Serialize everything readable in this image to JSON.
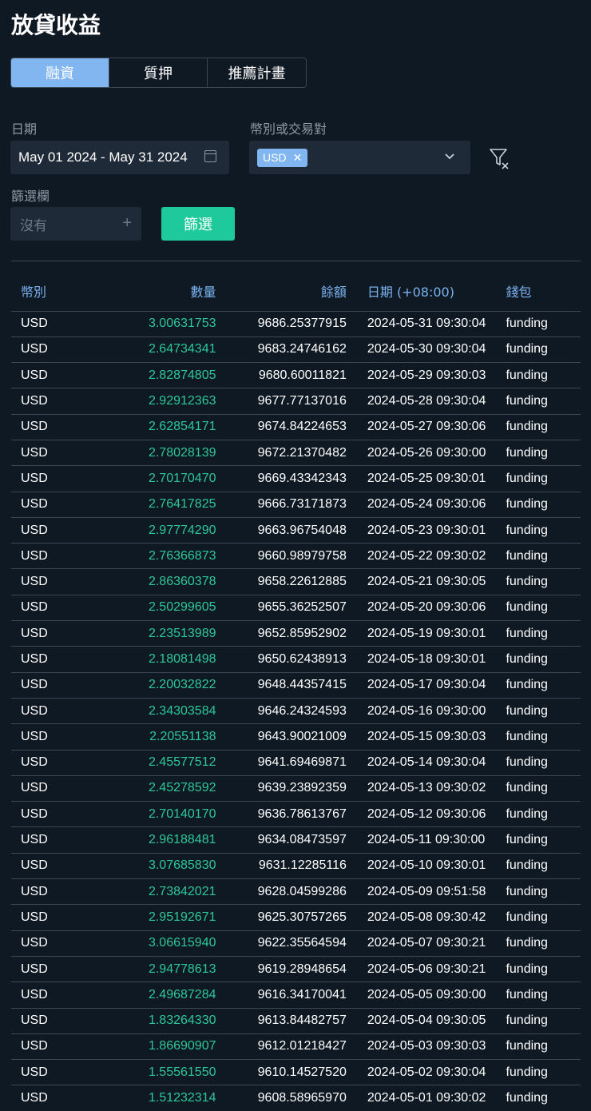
{
  "page": {
    "title": "放貸收益"
  },
  "tabs": [
    {
      "label": "融資",
      "active": true
    },
    {
      "label": "質押",
      "active": false
    },
    {
      "label": "推薦計畫",
      "active": false
    }
  ],
  "filters": {
    "date_label": "日期",
    "date_range": "May 01 2024 - May 31 2024",
    "currency_label": "幣別或交易對",
    "currency_chip": "USD",
    "chip_remove_icon": "close-icon",
    "filter_col_label": "篩選欄",
    "filter_col_placeholder": "沒有",
    "filter_button": "篩選"
  },
  "colors": {
    "accent_blue": "#82b6f0",
    "green": "#1ec99b",
    "amount_green": "#2ec79a",
    "bg": "#0f1923"
  },
  "table": {
    "headers": [
      "幣別",
      "數量",
      "餘額",
      "日期 (+08:00)",
      "錢包"
    ],
    "rows": [
      [
        "USD",
        "3.00631753",
        "9686.25377915",
        "2024-05-31 09:30:04",
        "funding"
      ],
      [
        "USD",
        "2.64734341",
        "9683.24746162",
        "2024-05-30 09:30:04",
        "funding"
      ],
      [
        "USD",
        "2.82874805",
        "9680.60011821",
        "2024-05-29 09:30:03",
        "funding"
      ],
      [
        "USD",
        "2.92912363",
        "9677.77137016",
        "2024-05-28 09:30:04",
        "funding"
      ],
      [
        "USD",
        "2.62854171",
        "9674.84224653",
        "2024-05-27 09:30:06",
        "funding"
      ],
      [
        "USD",
        "2.78028139",
        "9672.21370482",
        "2024-05-26 09:30:00",
        "funding"
      ],
      [
        "USD",
        "2.70170470",
        "9669.43342343",
        "2024-05-25 09:30:01",
        "funding"
      ],
      [
        "USD",
        "2.76417825",
        "9666.73171873",
        "2024-05-24 09:30:06",
        "funding"
      ],
      [
        "USD",
        "2.97774290",
        "9663.96754048",
        "2024-05-23 09:30:01",
        "funding"
      ],
      [
        "USD",
        "2.76366873",
        "9660.98979758",
        "2024-05-22 09:30:02",
        "funding"
      ],
      [
        "USD",
        "2.86360378",
        "9658.22612885",
        "2024-05-21 09:30:05",
        "funding"
      ],
      [
        "USD",
        "2.50299605",
        "9655.36252507",
        "2024-05-20 09:30:06",
        "funding"
      ],
      [
        "USD",
        "2.23513989",
        "9652.85952902",
        "2024-05-19 09:30:01",
        "funding"
      ],
      [
        "USD",
        "2.18081498",
        "9650.62438913",
        "2024-05-18 09:30:01",
        "funding"
      ],
      [
        "USD",
        "2.20032822",
        "9648.44357415",
        "2024-05-17 09:30:04",
        "funding"
      ],
      [
        "USD",
        "2.34303584",
        "9646.24324593",
        "2024-05-16 09:30:00",
        "funding"
      ],
      [
        "USD",
        "2.20551138",
        "9643.90021009",
        "2024-05-15 09:30:03",
        "funding"
      ],
      [
        "USD",
        "2.45577512",
        "9641.69469871",
        "2024-05-14 09:30:04",
        "funding"
      ],
      [
        "USD",
        "2.45278592",
        "9639.23892359",
        "2024-05-13 09:30:02",
        "funding"
      ],
      [
        "USD",
        "2.70140170",
        "9636.78613767",
        "2024-05-12 09:30:06",
        "funding"
      ],
      [
        "USD",
        "2.96188481",
        "9634.08473597",
        "2024-05-11 09:30:00",
        "funding"
      ],
      [
        "USD",
        "3.07685830",
        "9631.12285116",
        "2024-05-10 09:30:01",
        "funding"
      ],
      [
        "USD",
        "2.73842021",
        "9628.04599286",
        "2024-05-09 09:51:58",
        "funding"
      ],
      [
        "USD",
        "2.95192671",
        "9625.30757265",
        "2024-05-08 09:30:42",
        "funding"
      ],
      [
        "USD",
        "3.06615940",
        "9622.35564594",
        "2024-05-07 09:30:21",
        "funding"
      ],
      [
        "USD",
        "2.94778613",
        "9619.28948654",
        "2024-05-06 09:30:21",
        "funding"
      ],
      [
        "USD",
        "2.49687284",
        "9616.34170041",
        "2024-05-05 09:30:00",
        "funding"
      ],
      [
        "USD",
        "1.83264330",
        "9613.84482757",
        "2024-05-04 09:30:05",
        "funding"
      ],
      [
        "USD",
        "1.86690907",
        "9612.01218427",
        "2024-05-03 09:30:03",
        "funding"
      ],
      [
        "USD",
        "1.55561550",
        "9610.14527520",
        "2024-05-02 09:30:04",
        "funding"
      ],
      [
        "USD",
        "1.51232314",
        "9608.58965970",
        "2024-05-01 09:30:02",
        "funding"
      ]
    ]
  }
}
